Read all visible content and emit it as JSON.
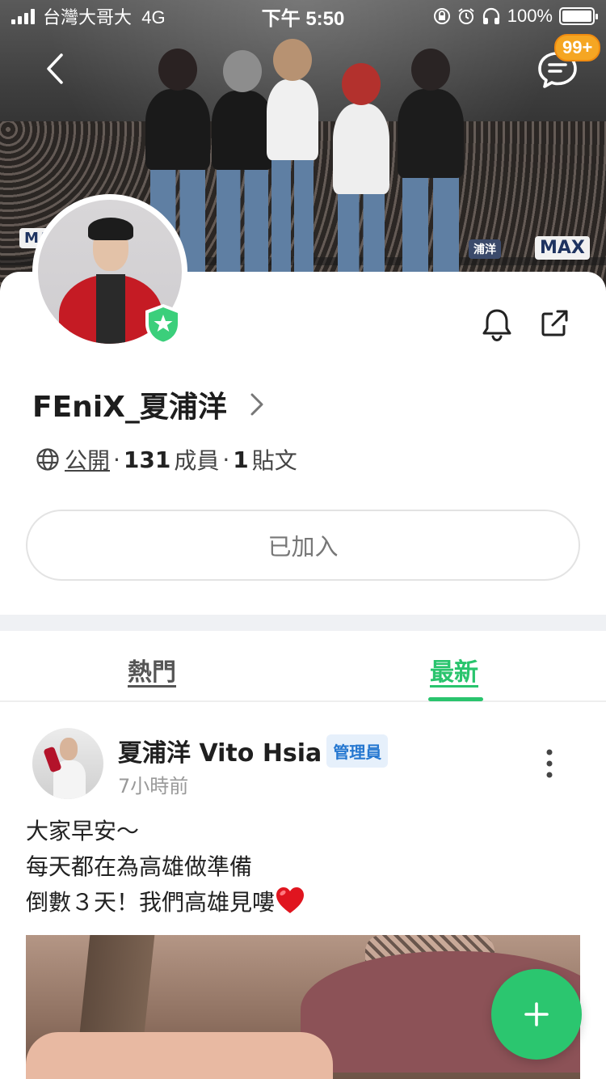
{
  "status_bar": {
    "carrier": "台灣大哥大",
    "network": "4G",
    "time": "下午 5:50",
    "battery": "100%",
    "battery_level": 1.0
  },
  "header": {
    "chat_badge": "99+",
    "cover_signs": [
      "MAX",
      "MA",
      "浦洋"
    ]
  },
  "group": {
    "name": "FEniX_夏浦洋",
    "visibility": "公開",
    "members_count": "131",
    "members_label": "成員",
    "posts_count": "1",
    "posts_label": "貼文",
    "join_button": "已加入"
  },
  "tabs": [
    {
      "label": "熱門",
      "active": false
    },
    {
      "label": "最新",
      "active": true
    }
  ],
  "post": {
    "author": "夏浦洋 Vito Hsia",
    "role_badge": "管理員",
    "time": "7小時前",
    "lines": [
      "大家早安～",
      "每天都在為高雄做準備",
      "倒數３天！我們高雄見嘍"
    ]
  },
  "colors": {
    "accent": "#29c46d",
    "badge": "#f5a623",
    "admin_badge_text": "#2577d0"
  },
  "icons": [
    "back-icon",
    "chat-icon",
    "verified-shield-icon",
    "bell-icon",
    "share-icon",
    "chevron-right-icon",
    "globe-icon",
    "more-vertical-icon",
    "heart-emoji",
    "plus-icon"
  ]
}
